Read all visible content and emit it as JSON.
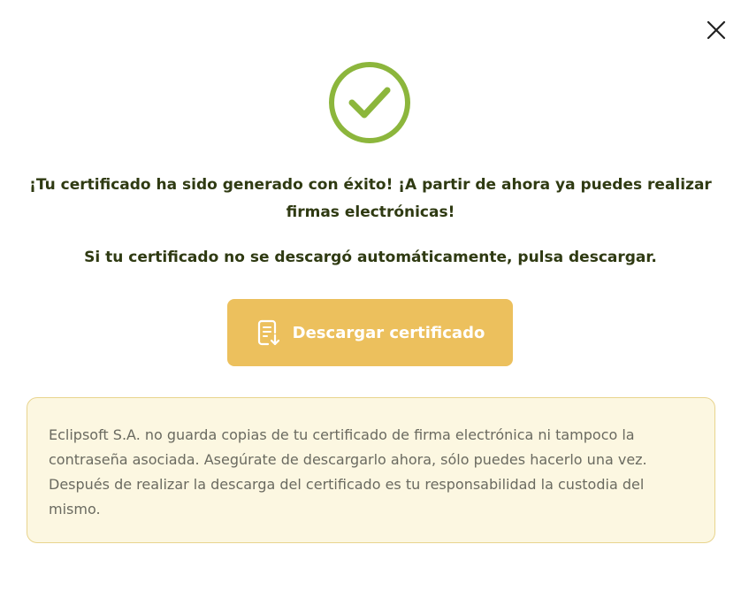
{
  "dialog": {
    "close_icon": "close-icon",
    "success_icon": "check-circle-icon",
    "success_message": "¡Tu certificado ha sido generado con éxito! ¡A partir de ahora ya puedes realizar firmas electrónicas!",
    "hint_message": "Si tu certificado no se descargó automáticamente, pulsa descargar.",
    "download_button": {
      "label": "Descargar certificado",
      "icon": "document-download-icon"
    },
    "notice_text": "Eclipsoft S.A. no guarda copias de tu certificado de firma electrónica ni tampoco la contraseña asociada. Asegúrate de descargarlo ahora, sólo puedes hacerlo una vez. Después de realizar la descarga del certificado es tu responsabilidad la custodia del mismo."
  },
  "colors": {
    "success_green": "#8cb63c",
    "button_yellow": "#ecc05d",
    "text_dark": "#2f3a12",
    "notice_bg": "#fcf7e1",
    "notice_border": "#e8d48e",
    "notice_text": "#6a6a60"
  }
}
